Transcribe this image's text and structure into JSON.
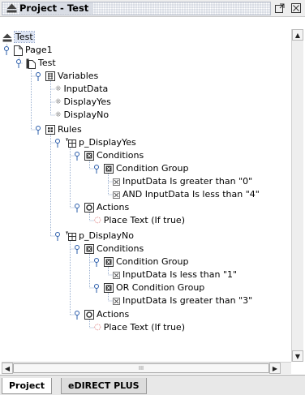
{
  "window": {
    "title": "Project - Test",
    "restore_icon": "restore-icon",
    "close_icon": "close-icon"
  },
  "tree": {
    "root": "Test",
    "page": "Page1",
    "project": "Test",
    "variables": {
      "label": "Variables",
      "items": [
        "InputData",
        "DisplayYes",
        "DisplayNo"
      ]
    },
    "rules": {
      "label": "Rules",
      "rule1": {
        "name": "p_DisplayYes",
        "conditions": "Conditions",
        "group": "Condition Group",
        "cond1": "InputData Is greater than \"0\"",
        "cond2": "AND InputData Is less than \"4\"",
        "actions": "Actions",
        "action": "Place Text (If true)"
      },
      "rule2": {
        "name": "p_DisplayNo",
        "conditions": "Conditions",
        "group1": "Condition Group",
        "cond1": "InputData Is less than \"1\"",
        "group2": "OR Condition Group",
        "cond2": "InputData Is greater than \"3\"",
        "actions": "Actions",
        "action": "Place Text (If true)"
      }
    }
  },
  "scrollbar": {
    "h_thumb_label": "III"
  },
  "tabs": [
    "Project",
    "eDIRECT PLUS"
  ]
}
